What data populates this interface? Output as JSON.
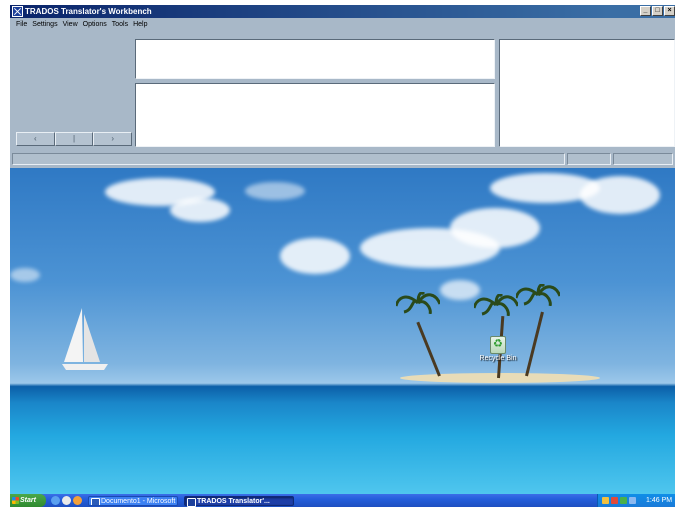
{
  "window": {
    "title": "TRADOS Translator's Workbench",
    "controls": {
      "minimize": "_",
      "maximize": "□",
      "close": "×"
    }
  },
  "menu": [
    "File",
    "Settings",
    "View",
    "Options",
    "Tools",
    "Help"
  ],
  "nav_buttons": [
    "‹",
    "|",
    "›"
  ],
  "desktop": {
    "recycle_bin_label": "Recycle Bin"
  },
  "taskbar": {
    "start_label": "Start",
    "tasks": [
      {
        "label": "Documento1 - Microsoft ..."
      },
      {
        "label": "TRADOS Translator'..."
      }
    ],
    "clock": "1:46 PM"
  },
  "colors": {
    "title_bar": "#0a246a",
    "window_face": "#a8b8c8",
    "taskbar": "#245edb",
    "start": "#3b9a3b"
  }
}
